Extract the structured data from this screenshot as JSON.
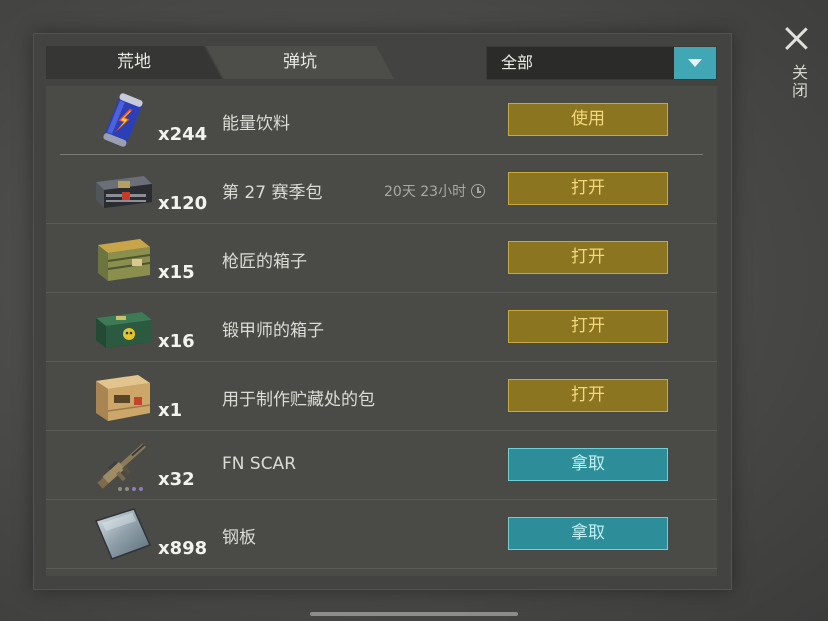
{
  "tabs": {
    "wasteland": "荒地",
    "crater": "弹坑"
  },
  "filter": {
    "value": "全部"
  },
  "close": {
    "label": "关闭"
  },
  "items": [
    {
      "name": "能量饮料",
      "qty": "x244",
      "action": "使用",
      "icon": "energy-drink-icon",
      "style": "gold"
    },
    {
      "name": "第 27 赛季包",
      "qty": "x120",
      "action": "打开",
      "timer": "20天 23小时",
      "icon": "season-box-icon",
      "style": "gold"
    },
    {
      "name": "枪匠的箱子",
      "qty": "x15",
      "action": "打开",
      "icon": "wooden-crate-icon",
      "style": "gold"
    },
    {
      "name": "锻甲师的箱子",
      "qty": "x16",
      "action": "打开",
      "icon": "green-chest-icon",
      "style": "gold"
    },
    {
      "name": "用于制作贮藏处的包",
      "qty": "x1",
      "action": "打开",
      "icon": "cardboard-crate-icon",
      "style": "gold"
    },
    {
      "name": "FN SCAR",
      "qty": "x32",
      "action": "拿取",
      "icon": "rifle-icon",
      "style": "teal"
    },
    {
      "name": "钢板",
      "qty": "x898",
      "action": "拿取",
      "icon": "steel-plate-icon",
      "style": "teal"
    }
  ],
  "colors": {
    "gold_button": "#8c7521",
    "teal_button": "#2d8d98",
    "accent": "#42a7b5"
  }
}
